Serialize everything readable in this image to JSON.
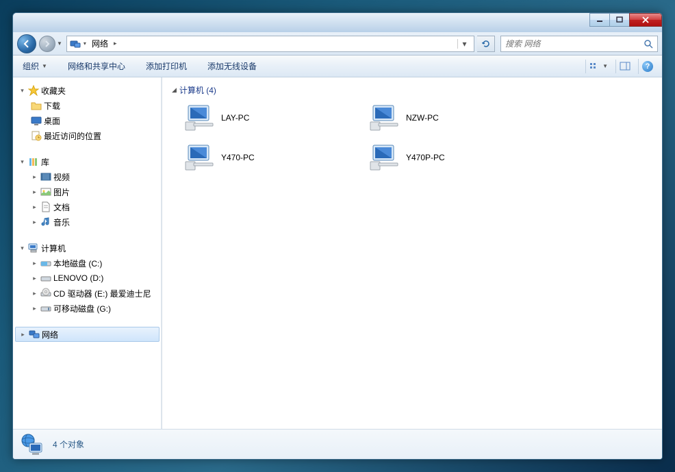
{
  "titlebar": {},
  "nav": {
    "address_root": "网络",
    "address_sep": "▸",
    "search_placeholder": "搜索 网络"
  },
  "toolbar": {
    "organize": "组织",
    "network_center": "网络和共享中心",
    "add_printer": "添加打印机",
    "add_wireless": "添加无线设备"
  },
  "sidebar": {
    "favorites": {
      "label": "收藏夹",
      "items": [
        "下载",
        "桌面",
        "最近访问的位置"
      ]
    },
    "libraries": {
      "label": "库",
      "items": [
        "视频",
        "图片",
        "文档",
        "音乐"
      ]
    },
    "computer": {
      "label": "计算机",
      "items": [
        "本地磁盘 (C:)",
        "LENOVO (D:)",
        "CD 驱动器 (E:) 最爱迪士尼",
        "可移动磁盘 (G:)"
      ]
    },
    "network": {
      "label": "网络"
    }
  },
  "content": {
    "group_label": "计算机 (4)",
    "items": [
      "LAY-PC",
      "NZW-PC",
      "Y470-PC",
      "Y470P-PC"
    ]
  },
  "status": {
    "text": "4 个对象"
  }
}
